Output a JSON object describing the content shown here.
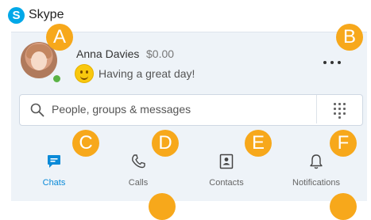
{
  "app": {
    "title": "Skype",
    "logo_letter": "S"
  },
  "profile": {
    "name": "Anna Davies",
    "balance": "$0.00",
    "mood": "Having a great day!",
    "presence": "online"
  },
  "search": {
    "placeholder": "People, groups & messages"
  },
  "tabs": [
    {
      "label": "Chats",
      "icon": "chat-icon",
      "active": true
    },
    {
      "label": "Calls",
      "icon": "phone-icon",
      "active": false
    },
    {
      "label": "Contacts",
      "icon": "contacts-icon",
      "active": false
    },
    {
      "label": "Notifications",
      "icon": "bell-icon",
      "active": false
    }
  ],
  "callouts": [
    "A",
    "B",
    "C",
    "D",
    "E",
    "F"
  ],
  "colors": {
    "accent": "#0a8ad8",
    "callout": "#f7a81b",
    "presence": "#5bb345",
    "skype": "#00a8e8"
  }
}
